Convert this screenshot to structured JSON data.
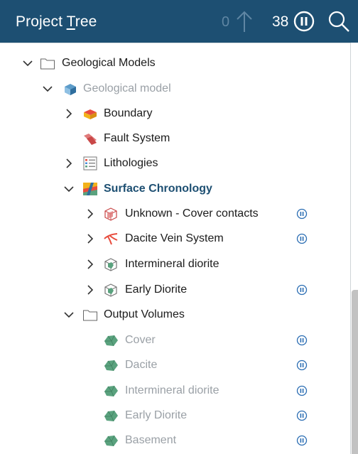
{
  "header": {
    "title_pre": "Project ",
    "title_u": "T",
    "title_post": "ree",
    "zero_count": "0",
    "count": "38"
  },
  "tree": {
    "geological_models": "Geological Models",
    "geological_model": "Geological model",
    "boundary": "Boundary",
    "fault_system": "Fault System",
    "lithologies": "Lithologies",
    "surface_chronology": "Surface Chronology",
    "unknown_cover": "Unknown - Cover contacts",
    "dacite_vein": "Dacite Vein System",
    "intermineral": "Intermineral diorite",
    "early_diorite": "Early Diorite",
    "output_volumes": "Output Volumes",
    "cover": "Cover",
    "dacite": "Dacite",
    "intermineral_vol": "Intermineral diorite",
    "early_diorite_vol": "Early Diorite",
    "basement": "Basement"
  },
  "colors": {
    "header_bg": "#1d4f72",
    "accent_blue": "#1d4f72",
    "pause_blue": "#2a6db3",
    "volume_green": "#5aa27e"
  }
}
